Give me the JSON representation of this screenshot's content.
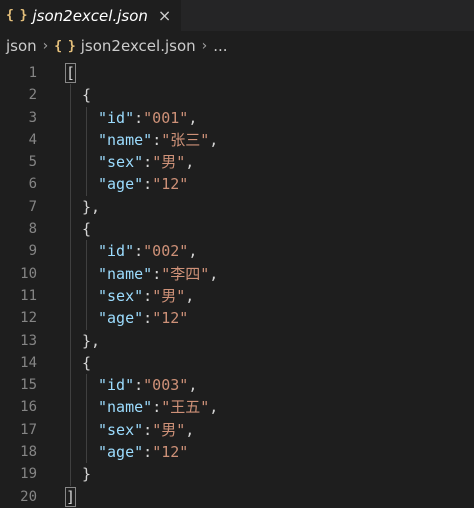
{
  "tab": {
    "icon": "{ }",
    "icon_name": "json-file-icon",
    "label": "json2excel.json",
    "close": "×"
  },
  "breadcrumb": {
    "folder": "json",
    "sep": "›",
    "file_icon": "{ }",
    "file": "json2excel.json",
    "more": "..."
  },
  "colors": {
    "background": "#1e1e1e",
    "key": "#9cdcfe",
    "string": "#ce9178",
    "punctuation": "#d4d4d4",
    "line_number": "#858585",
    "icon": "#e5c07b"
  },
  "lines": [
    {
      "n": "1",
      "indent": 0,
      "tokens": [
        {
          "t": "[",
          "c": "p"
        }
      ]
    },
    {
      "n": "2",
      "indent": 1,
      "tokens": [
        {
          "t": "{",
          "c": "p"
        }
      ]
    },
    {
      "n": "3",
      "indent": 2,
      "tokens": [
        {
          "t": "\"id\"",
          "c": "k"
        },
        {
          "t": ":",
          "c": "p"
        },
        {
          "t": "\"001\"",
          "c": "s"
        },
        {
          "t": ",",
          "c": "p"
        }
      ]
    },
    {
      "n": "4",
      "indent": 2,
      "tokens": [
        {
          "t": "\"name\"",
          "c": "k"
        },
        {
          "t": ":",
          "c": "p"
        },
        {
          "t": "\"张三\"",
          "c": "s"
        },
        {
          "t": ",",
          "c": "p"
        }
      ]
    },
    {
      "n": "5",
      "indent": 2,
      "tokens": [
        {
          "t": "\"sex\"",
          "c": "k"
        },
        {
          "t": ":",
          "c": "p"
        },
        {
          "t": "\"男\"",
          "c": "s"
        },
        {
          "t": ",",
          "c": "p"
        }
      ]
    },
    {
      "n": "6",
      "indent": 2,
      "tokens": [
        {
          "t": "\"age\"",
          "c": "k"
        },
        {
          "t": ":",
          "c": "p"
        },
        {
          "t": "\"12\"",
          "c": "s"
        }
      ]
    },
    {
      "n": "7",
      "indent": 1,
      "tokens": [
        {
          "t": "},",
          "c": "p"
        }
      ]
    },
    {
      "n": "8",
      "indent": 1,
      "tokens": [
        {
          "t": "{",
          "c": "p"
        }
      ]
    },
    {
      "n": "9",
      "indent": 2,
      "tokens": [
        {
          "t": "\"id\"",
          "c": "k"
        },
        {
          "t": ":",
          "c": "p"
        },
        {
          "t": "\"002\"",
          "c": "s"
        },
        {
          "t": ",",
          "c": "p"
        }
      ]
    },
    {
      "n": "10",
      "indent": 2,
      "tokens": [
        {
          "t": "\"name\"",
          "c": "k"
        },
        {
          "t": ":",
          "c": "p"
        },
        {
          "t": "\"李四\"",
          "c": "s"
        },
        {
          "t": ",",
          "c": "p"
        }
      ]
    },
    {
      "n": "11",
      "indent": 2,
      "tokens": [
        {
          "t": "\"sex\"",
          "c": "k"
        },
        {
          "t": ":",
          "c": "p"
        },
        {
          "t": "\"男\"",
          "c": "s"
        },
        {
          "t": ",",
          "c": "p"
        }
      ]
    },
    {
      "n": "12",
      "indent": 2,
      "tokens": [
        {
          "t": "\"age\"",
          "c": "k"
        },
        {
          "t": ":",
          "c": "p"
        },
        {
          "t": "\"12\"",
          "c": "s"
        }
      ]
    },
    {
      "n": "13",
      "indent": 1,
      "tokens": [
        {
          "t": "},",
          "c": "p"
        }
      ]
    },
    {
      "n": "14",
      "indent": 1,
      "tokens": [
        {
          "t": "{",
          "c": "p"
        }
      ]
    },
    {
      "n": "15",
      "indent": 2,
      "tokens": [
        {
          "t": "\"id\"",
          "c": "k"
        },
        {
          "t": ":",
          "c": "p"
        },
        {
          "t": "\"003\"",
          "c": "s"
        },
        {
          "t": ",",
          "c": "p"
        }
      ]
    },
    {
      "n": "16",
      "indent": 2,
      "tokens": [
        {
          "t": "\"name\"",
          "c": "k"
        },
        {
          "t": ":",
          "c": "p"
        },
        {
          "t": "\"王五\"",
          "c": "s"
        },
        {
          "t": ",",
          "c": "p"
        }
      ]
    },
    {
      "n": "17",
      "indent": 2,
      "tokens": [
        {
          "t": "\"sex\"",
          "c": "k"
        },
        {
          "t": ":",
          "c": "p"
        },
        {
          "t": "\"男\"",
          "c": "s"
        },
        {
          "t": ",",
          "c": "p"
        }
      ]
    },
    {
      "n": "18",
      "indent": 2,
      "tokens": [
        {
          "t": "\"age\"",
          "c": "k"
        },
        {
          "t": ":",
          "c": "p"
        },
        {
          "t": "\"12\"",
          "c": "s"
        }
      ]
    },
    {
      "n": "19",
      "indent": 1,
      "tokens": [
        {
          "t": "}",
          "c": "p"
        }
      ]
    },
    {
      "n": "20",
      "indent": 0,
      "tokens": [
        {
          "t": "]",
          "c": "p"
        }
      ]
    }
  ]
}
